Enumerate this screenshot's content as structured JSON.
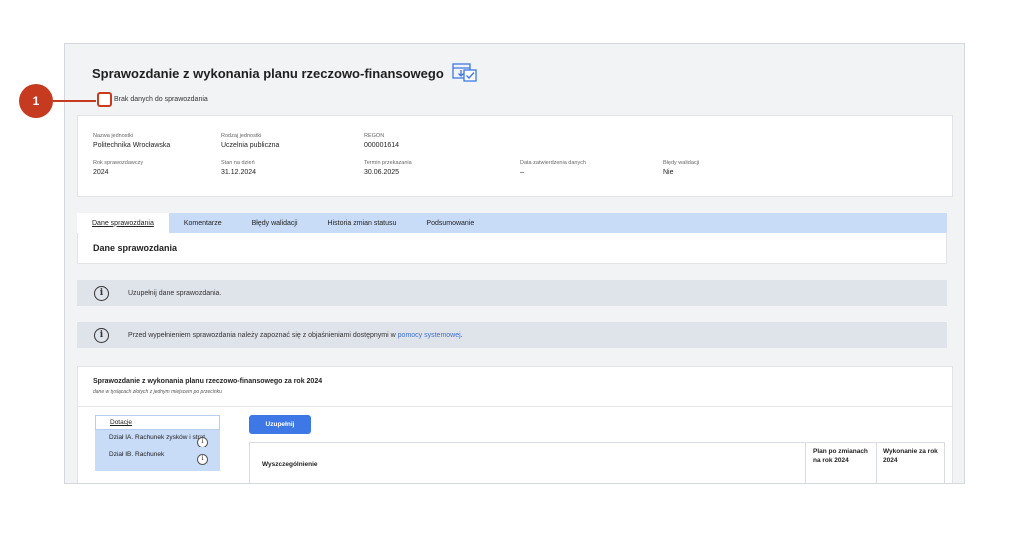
{
  "title": "Sprawozdanie z wykonania planu rzeczowo-finansowego",
  "callout_number": "1",
  "nodata_label": "Brak danych do sprawozdania",
  "info": [
    {
      "label": "Nazwa jednostki",
      "value": "Politechnika Wrocławska"
    },
    {
      "label": "Rodzaj jednostki",
      "value": "Uczelnia publiczna"
    },
    {
      "label": "REGON",
      "value": "000001614"
    },
    {
      "label": "",
      "value": ""
    },
    {
      "label": "",
      "value": ""
    },
    {
      "label": "Rok sprawozdawczy",
      "value": "2024"
    },
    {
      "label": "Stan na dzień",
      "value": "31.12.2024"
    },
    {
      "label": "Termin przekazania",
      "value": "30.06.2025"
    },
    {
      "label": "Data zatwierdzenia danych",
      "value": "–"
    },
    {
      "label": "Błędy walidacji",
      "value": "Nie"
    }
  ],
  "tabs": [
    "Dane sprawozdania",
    "Komentarze",
    "Błędy walidacji",
    "Historia zmian statusu",
    "Podsumowanie"
  ],
  "section_title": "Dane sprawozdania",
  "alert1": "Uzupełnij dane sprawozdania.",
  "alert2": {
    "text": "Przed wypełnieniem sprawozdania należy zapoznać się z objaśnieniami dostępnymi w",
    "link": "pomocy systemowej",
    "suffix": "."
  },
  "report": {
    "title": "Sprawozdanie z wykonania planu rzeczowo-finansowego za rok 2024",
    "subtitle": "dane w tysiącach złotych z jednym miejscem po przecinku",
    "sidebar": [
      "Dotacje",
      "Dział IA. Rachunek zysków i strat",
      "Dział IB. Rachunek"
    ],
    "button": "Uzupełnij",
    "columns": [
      "Wyszczególnienie",
      "Plan po zmianach na rok 2024",
      "Wykonanie za rok 2024"
    ]
  },
  "colors": {
    "accent": "#3e78e6",
    "callout": "#c63a1f",
    "tab_bg": "#c8dbf7"
  }
}
